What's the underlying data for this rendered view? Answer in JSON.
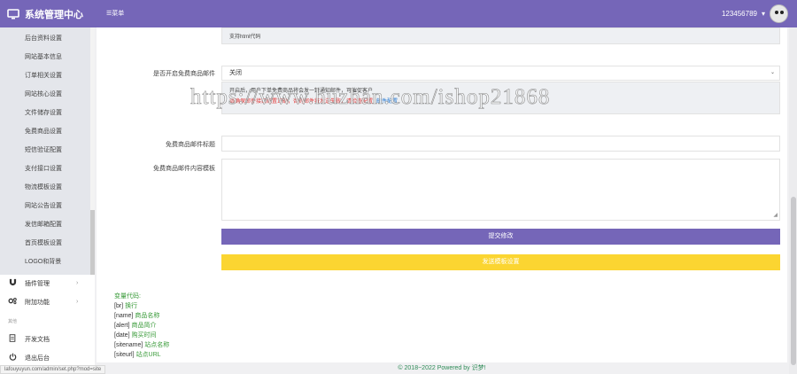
{
  "header": {
    "brand_title": "系统管理中心",
    "menu_toggle": "☰菜单",
    "username": "123456789",
    "dropdown_caret": "▾"
  },
  "sidebar": {
    "subitems": [
      {
        "label": "后台资料设置"
      },
      {
        "label": "网站基本信息"
      },
      {
        "label": "订单相关设置"
      },
      {
        "label": "网站核心设置"
      },
      {
        "label": "文件储存设置"
      },
      {
        "label": "免费商品设置"
      },
      {
        "label": "短信验证配置"
      },
      {
        "label": "支付接口设置"
      },
      {
        "label": "物流模板设置"
      },
      {
        "label": "网站公告设置"
      },
      {
        "label": "发信邮箱配置"
      },
      {
        "label": "首页模板设置"
      },
      {
        "label": "LOGO和背景"
      }
    ],
    "nav": [
      {
        "label": "插件管理",
        "icon": "magnet-icon",
        "arrow": "›"
      },
      {
        "label": "附加功能",
        "icon": "gears-icon",
        "arrow": "›"
      }
    ],
    "section_label": "其他",
    "bottom": [
      {
        "label": "开发文档",
        "icon": "document-icon"
      },
      {
        "label": "退出后台",
        "icon": "power-icon"
      }
    ]
  },
  "form": {
    "html_tip": "支持html代码",
    "enable_label": "是否开启免费商品邮件",
    "enable_value": "关闭",
    "info_line1": "开启后，用户下单免费商品将会发一封通知邮件，可催促客户",
    "info_line2": "请确保邮件接口配置正确，否则邮件将发送失败，请检查配置",
    "info_link": "邮件配置",
    "subject_label": "免费商品邮件标题",
    "subject_value": "",
    "content_label": "免费商品邮件内容模板",
    "content_value": "",
    "submit_label": "提交修改",
    "test_label": "发送模板设置"
  },
  "variables": {
    "title": "变量代码:",
    "items": [
      {
        "token": "[br]",
        "desc": "换行"
      },
      {
        "token": "[name]",
        "desc": "商品名称"
      },
      {
        "token": "[alert]",
        "desc": "商品简介"
      },
      {
        "token": "[date]",
        "desc": "购买时间"
      },
      {
        "token": "[sitename]",
        "desc": "站点名称"
      },
      {
        "token": "[siteurl]",
        "desc": "站点URL"
      }
    ]
  },
  "status_url": "lafouyuyun.com/admin/set.php?mod=site",
  "footer": "© 2018~2022 Powered by 识梦!",
  "watermark": "https://www.huzhan.com/ishop21868",
  "colors": {
    "accent": "#7566b8",
    "yellow": "#fbd531",
    "green": "#3a9b3a",
    "red": "#e23b3b"
  }
}
